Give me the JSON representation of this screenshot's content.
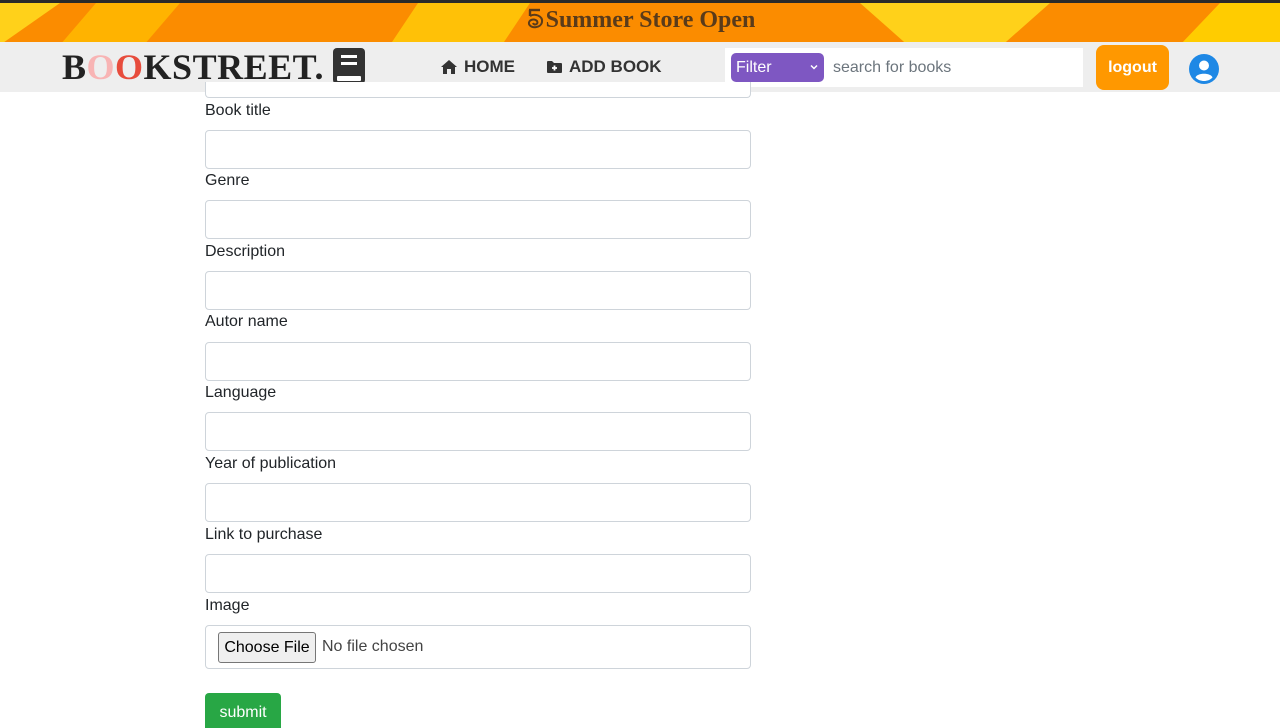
{
  "banner": {
    "text": "Summer Store Open",
    "icon": "spiral-five-icon"
  },
  "brand": {
    "part1": "B",
    "part2": "O",
    "part3": "O",
    "part4": "KSTREET.",
    "icon": "book-icon"
  },
  "nav": {
    "home_label": "HOME",
    "home_icon": "home-icon",
    "add_label": "ADD BOOK",
    "add_icon": "folder-plus-icon"
  },
  "search": {
    "filter_value": "Filter",
    "placeholder": "search for books",
    "value": ""
  },
  "account": {
    "logout_label": "logout",
    "avatar_icon": "user-circle-icon"
  },
  "form": {
    "fields": [
      {
        "label": "Book title",
        "value": ""
      },
      {
        "label": "Genre",
        "value": ""
      },
      {
        "label": "Description",
        "value": ""
      },
      {
        "label": "Autor name",
        "value": ""
      },
      {
        "label": "Language",
        "value": ""
      },
      {
        "label": "Year of publication",
        "value": ""
      },
      {
        "label": "Link to purchase",
        "value": ""
      }
    ],
    "image_label": "Image",
    "choose_file_label": "Choose File",
    "no_file_text": "No file chosen",
    "submit_label": "submit"
  },
  "colors": {
    "banner": "#fb8c00",
    "filter": "#7e57c2",
    "logout": "#ff9800",
    "avatar": "#1e88e5",
    "submit": "#28a745"
  }
}
